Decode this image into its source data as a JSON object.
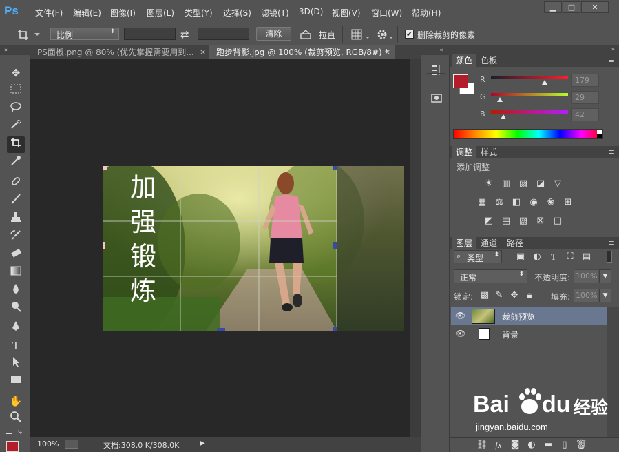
{
  "app": {
    "logo": "Ps"
  },
  "menu": [
    "文件(F)",
    "编辑(E)",
    "图像(I)",
    "图层(L)",
    "类型(Y)",
    "选择(S)",
    "滤镜(T)",
    "3D(D)",
    "视图(V)",
    "窗口(W)",
    "帮助(H)"
  ],
  "window_controls": {
    "minimize": "▁",
    "maximize": "□",
    "close": "✕"
  },
  "options": {
    "ratio_select": "比例",
    "swap_glyph": "⇄",
    "clear_button": "清除",
    "straighten_label": "拉直",
    "delete_pixels_checked": true,
    "delete_pixels_label": "删除裁剪的像素"
  },
  "tabs": [
    {
      "title": "PS面板.png @ 80% (优先掌握需要用到...",
      "close": "×"
    },
    {
      "title": "跑步背影.jpg @ 100% (裁剪预览, RGB/8#) *",
      "close": "×"
    }
  ],
  "image": {
    "overlay_text": [
      "加",
      "强",
      "锻",
      "炼"
    ]
  },
  "status": {
    "zoom": "100%",
    "doc_info": "文档:308.0 K/308.0K"
  },
  "color_panel": {
    "tabs": [
      "颜色",
      "色板"
    ],
    "fg_color": "#b31d2a",
    "r_label": "R",
    "r_value": "179",
    "g_label": "G",
    "g_value": "29",
    "b_label": "B",
    "b_value": "42"
  },
  "adjust_panel": {
    "tabs": [
      "调整",
      "样式"
    ],
    "title": "添加调整"
  },
  "layers_panel": {
    "tabs": [
      "图层",
      "通道",
      "路径"
    ],
    "filter_kind": "类型",
    "blend_mode": "正常",
    "opacity_label": "不透明度:",
    "opacity_value": "100%",
    "lock_label": "锁定:",
    "fill_label": "填充:",
    "fill_value": "100%",
    "layers": [
      {
        "name": "裁剪预览",
        "selected": true
      },
      {
        "name": "背景",
        "selected": false
      }
    ]
  },
  "watermark": {
    "brand": "Bai",
    "brand2": "du",
    "brand_cn": "经验",
    "url": "jingyan.baidu.com"
  }
}
